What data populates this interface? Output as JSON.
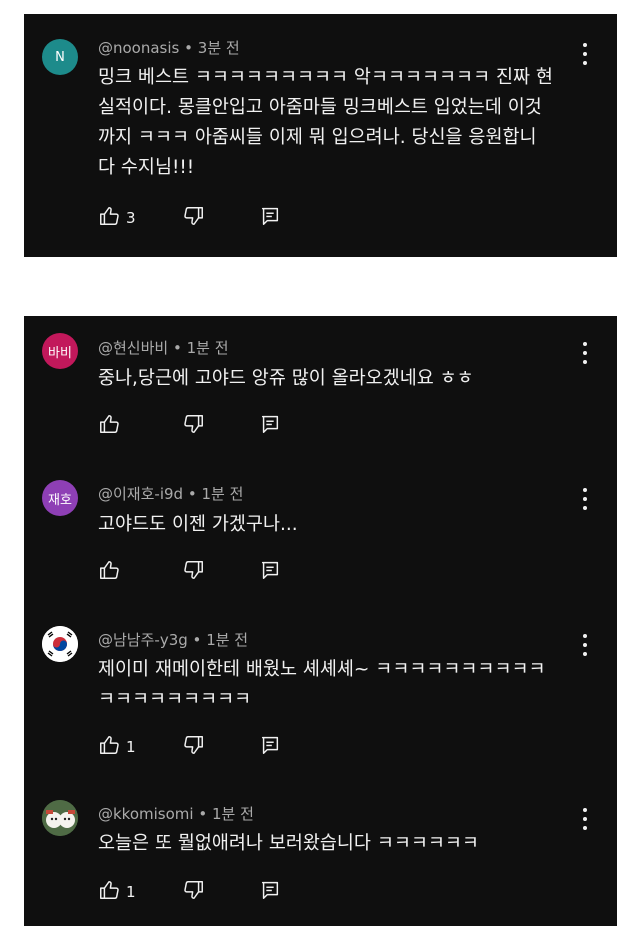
{
  "comments": [
    {
      "handle": "@noonasis",
      "time": "3분 전",
      "avatar_text": "N",
      "avatar_color": "#1d8b8b",
      "text": "밍크 베스트 ㅋㅋㅋㅋㅋㅋㅋㅋㅋ 악ㅋㅋㅋㅋㅋㅋㅋ 진짜 현\n실적이다. 몽클안입고 아줌마들 밍크베스트 입었는데 이것\n까지 ㅋㅋㅋ 아줌씨들 이제 뭐 입으려나. 당신을 응원합니\n다 수지님!!!",
      "likes": "3"
    },
    {
      "handle": "@현신바비",
      "time": "1분 전",
      "avatar_text": "바비",
      "avatar_color": "#c2185b",
      "text": "중나,당근에 고야드 앙쥬 많이 올라오겠네요 ㅎㅎ",
      "likes": ""
    },
    {
      "handle": "@이재호-i9d",
      "time": "1분 전",
      "avatar_text": "재호",
      "avatar_color": "#8e3fb5",
      "text": "고야드도 이젠 가겠구나...",
      "likes": ""
    },
    {
      "handle": "@남남주-y3g",
      "time": "1분 전",
      "avatar_text": "",
      "avatar_color": "#ffffff",
      "text": "제이미 재메이한테 배웠노 셰셰셰~ ㅋㅋㅋㅋㅋㅋㅋㅋㅋㅋ\nㅋㅋㅋㅋㅋㅋㅋㅋㅋ",
      "likes": "1"
    },
    {
      "handle": "@kkomisomi",
      "time": "1분 전",
      "avatar_text": "",
      "avatar_color": "#d8d2c4",
      "text": "오늘은 또 뭘없애려나 보러왔습니다 ㅋㅋㅋㅋㅋㅋ",
      "likes": "1"
    }
  ],
  "separator": "•",
  "icons": [
    "thumbs-up-icon",
    "thumbs-down-icon",
    "reply-icon",
    "more-vert-icon"
  ]
}
